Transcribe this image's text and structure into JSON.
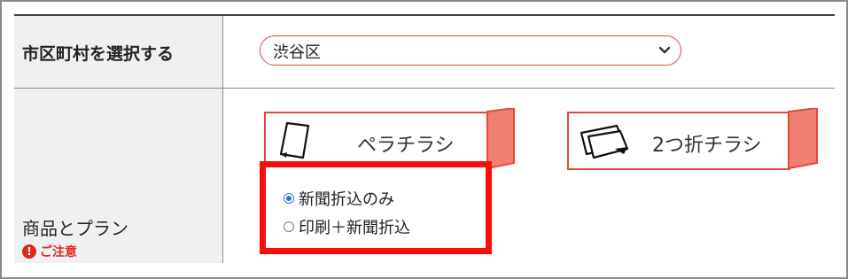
{
  "rows": {
    "municipality": {
      "label": "市区町村を選択する",
      "select": {
        "value": "渋谷区"
      }
    },
    "products": {
      "label": "商品とプラン",
      "note": "ご注意",
      "cards": [
        {
          "label": "ペラチラシ",
          "icon": "single-sheet-flyer-icon"
        },
        {
          "label": "2つ折チラシ",
          "icon": "folded-flyer-icon"
        }
      ],
      "plans": [
        {
          "label": "新聞折込のみ",
          "checked": true
        },
        {
          "label": "印刷＋新聞折込",
          "checked": false
        }
      ]
    }
  },
  "colors": {
    "accent": "#e04a3a",
    "highlight": "#ff0a0a",
    "label_bg": "#eef0f1",
    "radio_checked": "#2f6fd1"
  }
}
